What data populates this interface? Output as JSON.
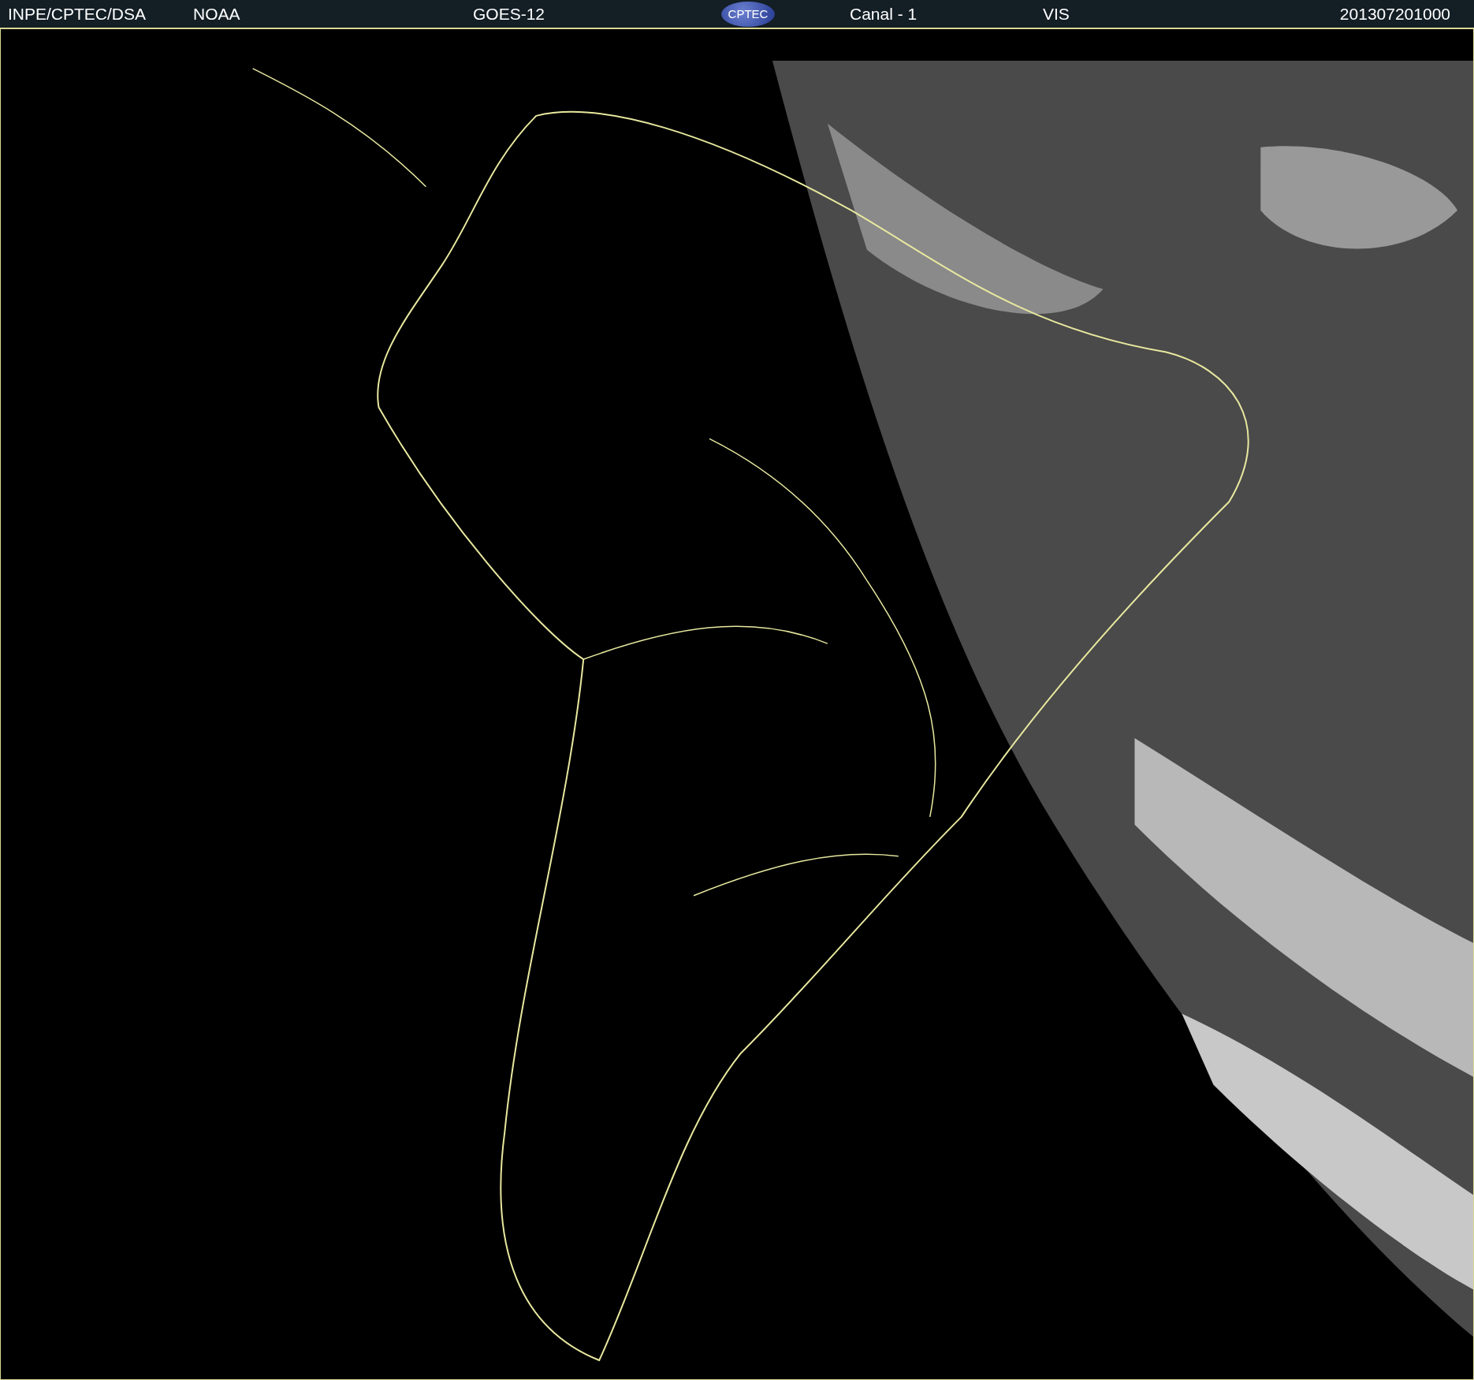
{
  "header": {
    "source": "INPE/CPTEC/DSA",
    "agency": "NOAA",
    "satellite": "GOES-12",
    "logo_text": "CPTEC",
    "channel": "Canal - 1",
    "band": "VIS",
    "timestamp": "201307201000"
  }
}
